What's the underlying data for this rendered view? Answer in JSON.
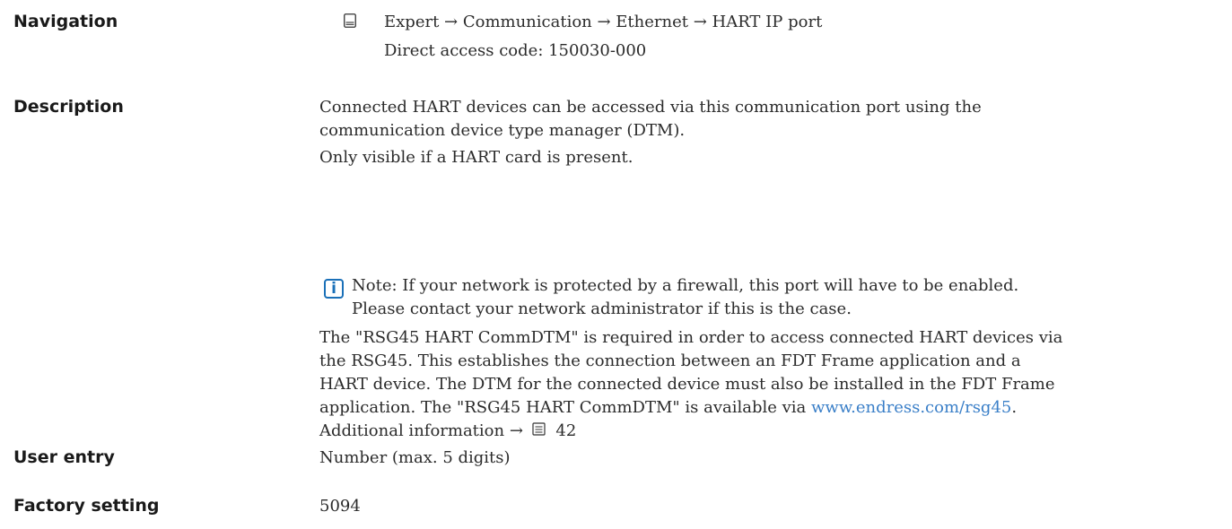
{
  "navigation": {
    "label": "Navigation",
    "path": "Expert → Communication → Ethernet → HART IP port",
    "access_code": "Direct access code: 150030-000",
    "icon": "menu-path-icon"
  },
  "description": {
    "label": "Description",
    "lines": [
      "Connected HART devices can be accessed via this communication port using the",
      "communication device type manager (DTM).",
      "Only visible if a HART card is present."
    ],
    "note_lines": [
      "Note: If your network is protected by a firewall, this port will have to be enabled.",
      "Please contact your network administrator if this is the case."
    ],
    "body_lines": [
      "The \"RSG45 HART CommDTM\" is required in order to access connected HART devices via",
      "the RSG45. This establishes the connection between an FDT Frame application and a",
      "HART device. The DTM for the connected device must also be installed in the FDT Frame"
    ],
    "last_line_prefix": "application. The \"RSG45 HART CommDTM\" is available via ",
    "link_text": "www.endress.com/rsg45",
    "last_line_suffix": ".",
    "additional_info": "Additional information →",
    "page_ref": "42",
    "info_icon_letter": "i",
    "link_color": "#3a7fc8",
    "info_color": "#1a70b8"
  },
  "user_entry": {
    "label": "User entry",
    "value": "Number (max. 5 digits)"
  },
  "factory_setting": {
    "label": "Factory setting",
    "value": "5094"
  }
}
